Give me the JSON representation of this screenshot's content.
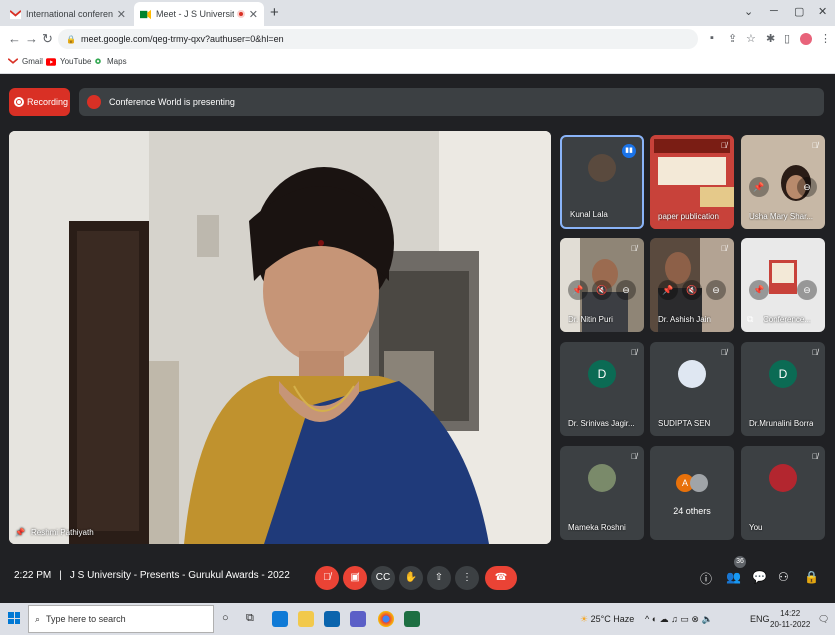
{
  "browser": {
    "tabs": [
      {
        "title": "International conference Mail",
        "active": false
      },
      {
        "title": "Meet - J S University - Presen",
        "active": true
      }
    ],
    "url": "meet.google.com/qeg-trmy-qxv?authuser=0&hl=en",
    "bookmarks": [
      "Gmail",
      "YouTube",
      "Maps"
    ]
  },
  "meet": {
    "recording_label": "Recording",
    "presenting_text": "Conference World is presenting",
    "main_speaker": "Reshmi Pathiyath",
    "tiles": [
      {
        "name": "Kunal Lala",
        "type": "avatar"
      },
      {
        "name": "paper publication",
        "type": "video"
      },
      {
        "name": "Usha Mary Shar...",
        "type": "video"
      },
      {
        "name": "Dr. Nitin Puri",
        "type": "video"
      },
      {
        "name": "Dr. Ashish Jain",
        "type": "video"
      },
      {
        "name": "Conference...",
        "type": "presentation"
      },
      {
        "name": "Dr. Srinivas Jagir...",
        "type": "initial",
        "initial": "D",
        "color": "#0b6b54"
      },
      {
        "name": "SUDIPTA SEN",
        "type": "avatar"
      },
      {
        "name": "Dr.Mrunalini Borra",
        "type": "initial",
        "initial": "D",
        "color": "#0b6b54"
      },
      {
        "name": "Mameka Roshni",
        "type": "avatar"
      },
      {
        "name": "24 others",
        "type": "others",
        "initial": "A"
      },
      {
        "name": "You",
        "type": "avatar"
      }
    ],
    "time": "2:22 PM",
    "meeting_title": "J S University - Presents - Gurukul Awards - 2022",
    "participant_count": "36"
  },
  "taskbar": {
    "search_placeholder": "Type here to search",
    "weather": "25°C  Haze",
    "lang": "ENG",
    "time": "14:22",
    "date": "20-11-2022"
  },
  "colors": {
    "end_call": "#ea4335",
    "recording": "#d93025",
    "active_tile_border": "#8ab4f8"
  }
}
